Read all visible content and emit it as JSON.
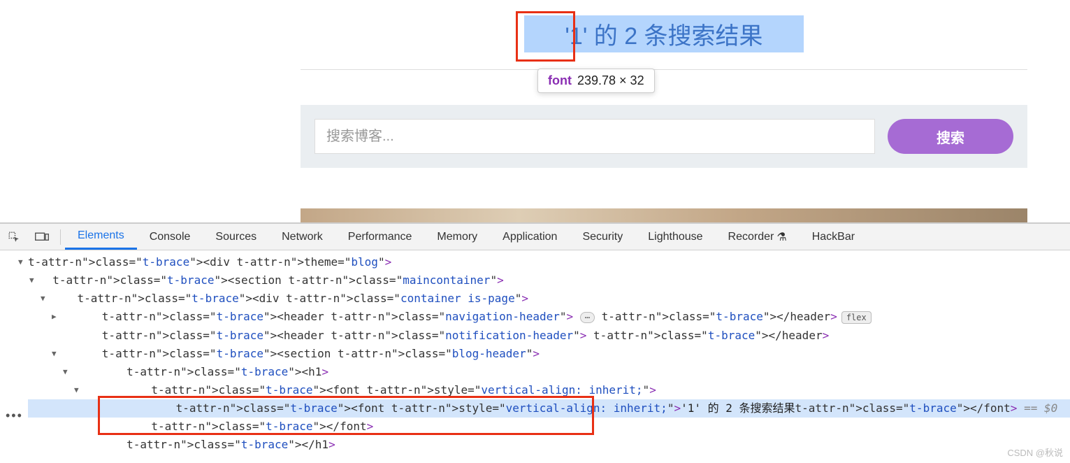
{
  "page": {
    "heading": "'1' 的 2 条搜索结果",
    "tooltip": {
      "tag": "font",
      "dimensions": "239.78 × 32"
    },
    "search": {
      "placeholder": "搜索博客...",
      "button_label": "搜索"
    }
  },
  "devtools": {
    "tabs": [
      "Elements",
      "Console",
      "Sources",
      "Network",
      "Performance",
      "Memory",
      "Application",
      "Security",
      "Lighthouse",
      "Recorder",
      "HackBar"
    ],
    "active_tab": "Elements",
    "flex_pill": "flex",
    "selected_ref": "== $0",
    "dom_lines": [
      {
        "indent": 0,
        "arrow": "down",
        "html": "<div theme=\"blog\">"
      },
      {
        "indent": 1,
        "arrow": "down",
        "html": "<section class=\"maincontainer\">"
      },
      {
        "indent": 2,
        "arrow": "down",
        "html": "<div class=\"container is-page\">"
      },
      {
        "indent": 3,
        "arrow": "right",
        "html": "<header class=\"navigation-header\">",
        "ellipsis": true,
        "close": "</header>",
        "flex": true
      },
      {
        "indent": 3,
        "arrow": "",
        "html": "<header class=\"notification-header\"> </header>"
      },
      {
        "indent": 3,
        "arrow": "down",
        "html": "<section class=\"blog-header\">"
      },
      {
        "indent": 4,
        "arrow": "down",
        "html": "<h1>"
      },
      {
        "indent": 5,
        "arrow": "down",
        "html": "<font style=\"vertical-align: inherit;\">"
      },
      {
        "indent": 6,
        "arrow": "",
        "highlight": true,
        "html": "<font style=\"vertical-align: inherit;\">",
        "text": "'1' 的 2 条搜索结果",
        "close": "</font>",
        "selref": true
      },
      {
        "indent": 5,
        "arrow": "",
        "html": "</font>"
      },
      {
        "indent": 4,
        "arrow": "",
        "html": "</h1>"
      }
    ]
  },
  "watermark": "CSDN @秋说"
}
